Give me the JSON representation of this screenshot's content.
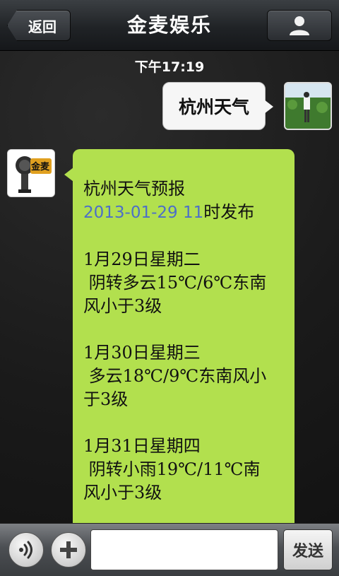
{
  "header": {
    "back_label": "返回",
    "title": "金麦娱乐",
    "profile_icon": "person-icon"
  },
  "timestamp": "下午17:19",
  "messages": {
    "outgoing": {
      "text": "杭州天气",
      "avatar_icon": "user-photo-avatar"
    },
    "incoming": {
      "avatar_icon": "jinmai-bot-avatar",
      "avatar_logo_text": "金麦",
      "title": "杭州天气预报",
      "publish_date": "2013-01-29 11",
      "publish_suffix": "时发布",
      "days": [
        {
          "date": "1月29日星期二",
          "line1": " 阴转多云15℃/6℃东南",
          "line2": "风小于3级"
        },
        {
          "date": "1月30日星期三",
          "line1": " 多云18℃/9℃东南风小",
          "line2": "于3级"
        },
        {
          "date": "1月31日星期四",
          "line1": " 阴转小雨19℃/11℃南",
          "line2": "风小于3级"
        }
      ],
      "bubble_color": "#b2e04e",
      "date_color": "#4c6fc8"
    }
  },
  "input_bar": {
    "voice_icon": "voice-icon",
    "plus_icon": "plus-icon",
    "input_value": "",
    "input_placeholder": "",
    "send_label": "发送"
  }
}
